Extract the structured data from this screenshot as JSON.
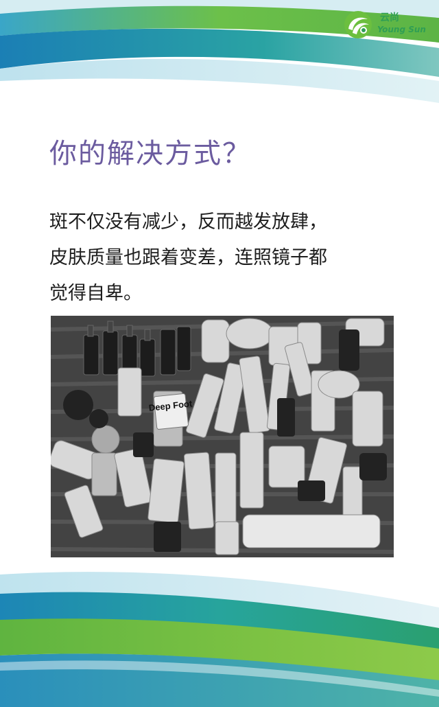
{
  "logo": {
    "chinese_name": "云尚",
    "english_name": "Young Sun"
  },
  "page": {
    "title": "你的解决方式？",
    "body_lines": [
      "斑不仅没有减少，反而越发放肆，",
      "皮肤质量也跟着变差，连照镜子都",
      "觉得自卑。"
    ]
  },
  "photo": {
    "label_text": "Deep Foot"
  },
  "colors": {
    "title": "#6b5b9f",
    "green": "#6dbb3a",
    "teal": "#2ea6a1",
    "blue": "#2a86b8",
    "body_text": "#1e1e1e"
  }
}
